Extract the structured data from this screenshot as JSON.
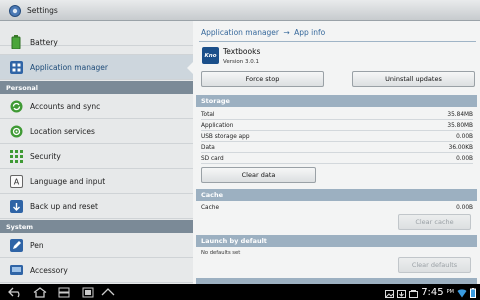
{
  "titlebar": {
    "title": "Settings"
  },
  "sidebar": {
    "items": [
      {
        "label": "Battery",
        "icon": "battery-icon"
      },
      {
        "label": "Application manager",
        "icon": "apps-grid-icon",
        "selected": true
      }
    ],
    "sections": [
      {
        "header": "Personal",
        "items": [
          {
            "label": "Accounts and sync",
            "icon": "sync-icon"
          },
          {
            "label": "Location services",
            "icon": "location-icon"
          },
          {
            "label": "Security",
            "icon": "security-grid-icon"
          },
          {
            "label": "Language and input",
            "icon": "keyboard-a-icon"
          },
          {
            "label": "Back up and reset",
            "icon": "backup-icon"
          }
        ]
      },
      {
        "header": "System",
        "items": [
          {
            "label": "Pen",
            "icon": "pen-icon"
          },
          {
            "label": "Accessory",
            "icon": "accessory-icon"
          }
        ]
      }
    ]
  },
  "breadcrumb": {
    "parent": "Application manager",
    "separator": "→",
    "current": "App info"
  },
  "app": {
    "name": "Textbooks",
    "version": "Version 3.0.1",
    "icon_text": "Kno"
  },
  "buttons": {
    "force_stop": "Force stop",
    "uninstall_updates": "Uninstall updates",
    "clear_data": "Clear data",
    "clear_cache": "Clear cache",
    "clear_defaults": "Clear defaults"
  },
  "storage": {
    "header": "Storage",
    "rows": [
      {
        "label": "Total",
        "value": "35.84MB"
      },
      {
        "label": "Application",
        "value": "35.80MB"
      },
      {
        "label": "USB storage app",
        "value": "0.00B"
      },
      {
        "label": "Data",
        "value": "36.00KB"
      },
      {
        "label": "SD card",
        "value": "0.00B"
      }
    ]
  },
  "cache": {
    "header": "Cache",
    "label": "Cache",
    "value": "0.00B"
  },
  "launch": {
    "header": "Launch by default",
    "note": "No defaults set"
  },
  "statusbar": {
    "time": "7:45",
    "ampm": "PM"
  },
  "colors": {
    "accent": "#36689b",
    "section": "#9cb0c1",
    "sidebar_header": "#7b8a97"
  }
}
